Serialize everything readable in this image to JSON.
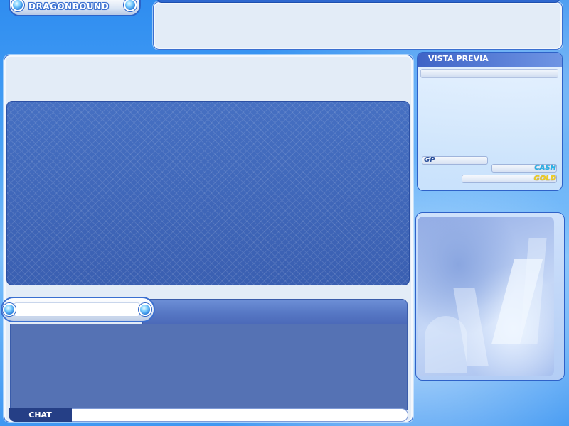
{
  "logo": {
    "text": "DRAGONBOUND"
  },
  "preview": {
    "title": "VISTA PREVIA",
    "gp_label": "GP",
    "cash_label": "CASH",
    "gold_label": "GOLD"
  },
  "chat": {
    "label": "CHAT",
    "input_value": ""
  },
  "colors": {
    "background": "#3f97f2",
    "panel": "#e3ecf7",
    "room_area": "#3e63b6",
    "chat_body": "#5572b4",
    "cash": "#24b6e8",
    "gold": "#f0d020"
  }
}
